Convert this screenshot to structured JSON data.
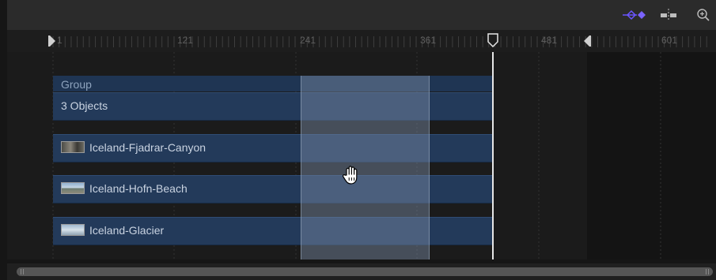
{
  "toolbar": {
    "icons": [
      "keyframe-diamond-icon",
      "snap-split-icon",
      "zoom-icon"
    ],
    "accent": "#6a55ff"
  },
  "ruler": {
    "ticks": [
      "1",
      "121",
      "241",
      "361",
      "481",
      "601"
    ]
  },
  "group": {
    "label": "Group",
    "objects_label": "3 Objects"
  },
  "tracks": [
    {
      "label": "Iceland-Fjadrar-Canyon",
      "thumb": "canyon-thumbnail"
    },
    {
      "label": "Iceland-Hofn-Beach",
      "thumb": "beach-thumbnail"
    },
    {
      "label": "Iceland-Glacier",
      "thumb": "glacier-thumbnail"
    }
  ],
  "colors": {
    "track": "#233a5a",
    "selection": "#7d8fa8",
    "playhead": "#ffffff"
  }
}
